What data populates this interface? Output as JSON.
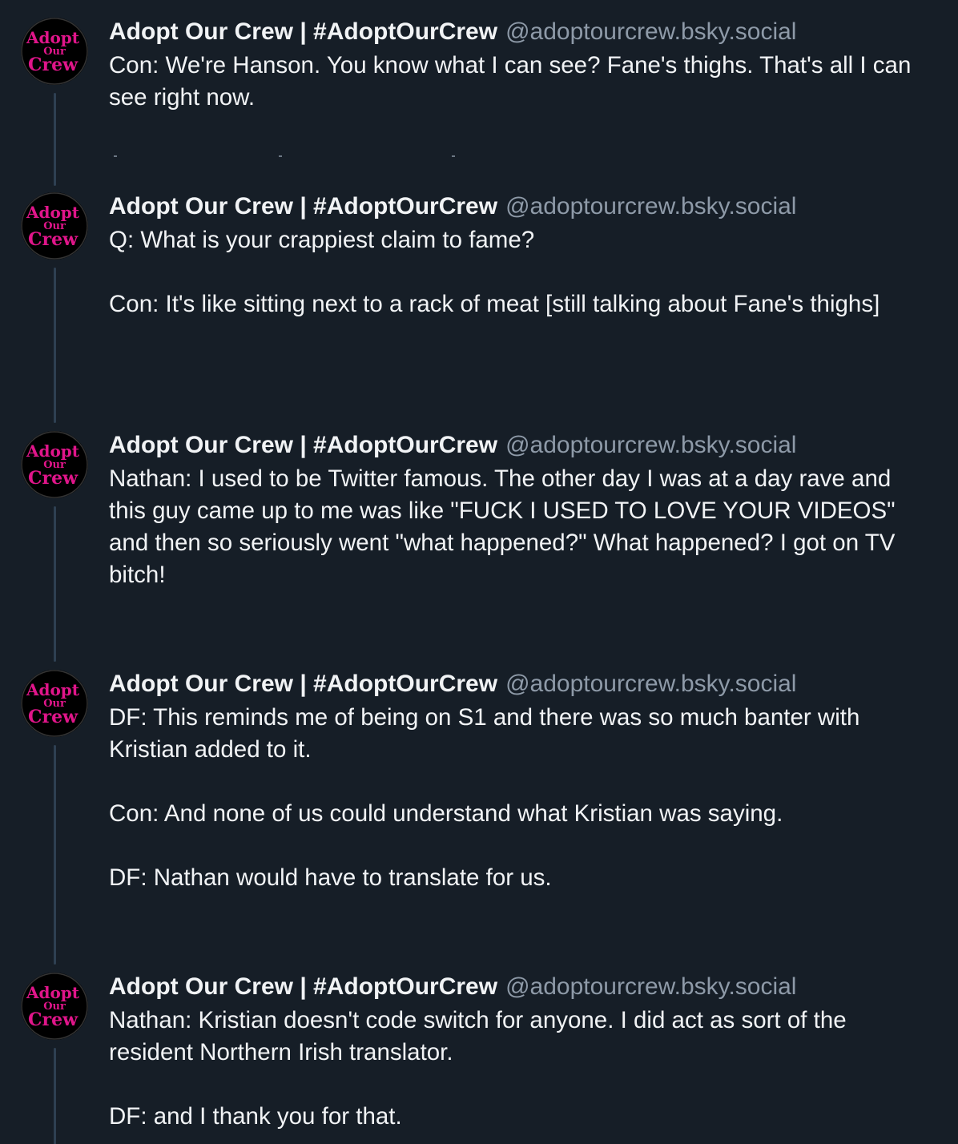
{
  "posts": [
    {
      "author_name": "Adopt Our Crew | #AdoptOurCrew",
      "author_handle": "@adoptourcrew.bsky.social",
      "text": "Con: We're Hanson. You know what I can see? Fane's thighs. That's all I can see right now."
    },
    {
      "author_name": "Adopt Our Crew | #AdoptOurCrew",
      "author_handle": "@adoptourcrew.bsky.social",
      "text": "Q: What is your crappiest claim to fame?\n\nCon: It's like sitting next to a rack of meat [still talking about Fane's thighs]"
    },
    {
      "author_name": "Adopt Our Crew | #AdoptOurCrew",
      "author_handle": "@adoptourcrew.bsky.social",
      "text": "Nathan: I used to be Twitter famous. The other day I was at a day rave and this guy came up to me was like \"FUCK I USED TO LOVE YOUR VIDEOS\" and then so seriously went \"what happened?\" What happened? I got on TV bitch!"
    },
    {
      "author_name": "Adopt Our Crew | #AdoptOurCrew",
      "author_handle": "@adoptourcrew.bsky.social",
      "text": "DF: This reminds me of being on S1 and there was so much banter with Kristian added to it.\n\nCon: And none of us could understand what Kristian was saying.\n\nDF: Nathan would have to translate for us."
    },
    {
      "author_name": "Adopt Our Crew | #AdoptOurCrew",
      "author_handle": "@adoptourcrew.bsky.social",
      "text": "Nathan: Kristian doesn't code switch for anyone. I did act as sort of the resident Northern Irish translator.\n\nDF: and I thank you for that."
    }
  ],
  "avatar": {
    "logo_lines": [
      "Adopt",
      "Our",
      "Crew"
    ],
    "logo_color": "#e0158a",
    "background": "#000000"
  },
  "colors": {
    "background": "#161e27",
    "thread_line": "#2e4052",
    "handle": "#8e9aa8",
    "text": "#f1f3f5"
  }
}
